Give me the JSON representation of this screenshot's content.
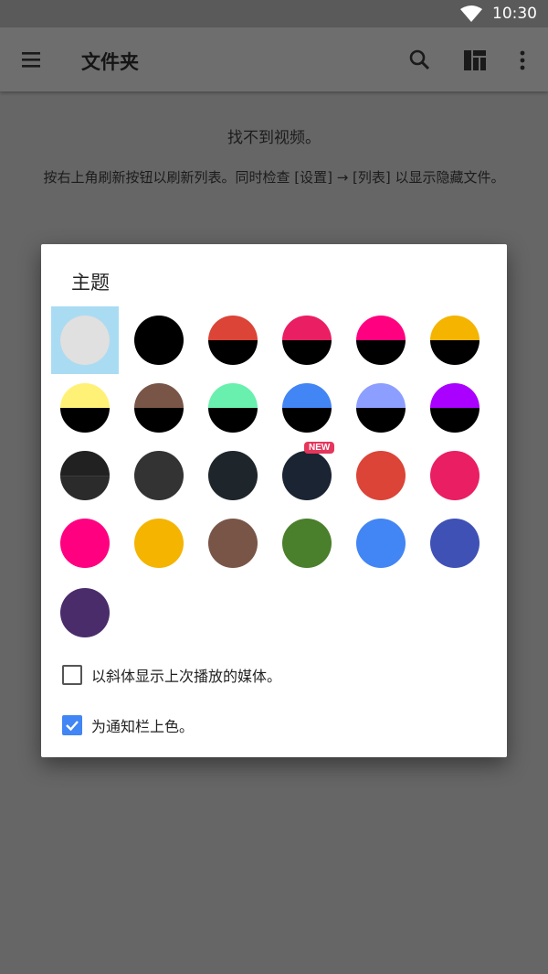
{
  "status_bar": {
    "time": "10:30",
    "wifi_icon": "wifi-icon"
  },
  "app_bar": {
    "title": "文件夹",
    "icons": [
      "menu-icon",
      "search-icon",
      "layout-grid-icon",
      "more-vert-icon"
    ]
  },
  "empty_state": {
    "title": "找不到视频。",
    "hint": "按右上角刷新按钮以刷新列表。同时检查 [设置] → [列表] 以显示隐藏文件。"
  },
  "theme_dialog": {
    "title": "主题",
    "selected_theme": "light-gray",
    "themes": [
      {
        "id": "light-gray",
        "top": "#e0e0e0",
        "bottom": "#e0e0e0"
      },
      {
        "id": "black",
        "top": "#000000",
        "bottom": "#000000"
      },
      {
        "id": "red-black",
        "top": "#db4437",
        "bottom": "#000000"
      },
      {
        "id": "pink-black",
        "top": "#e91e63",
        "bottom": "#000000"
      },
      {
        "id": "magenta-black",
        "top": "#ff0080",
        "bottom": "#000000"
      },
      {
        "id": "amber-black",
        "top": "#f4b400",
        "bottom": "#000000"
      },
      {
        "id": "yellow-black",
        "top": "#fff176",
        "bottom": "#000000"
      },
      {
        "id": "brown-black",
        "top": "#795548",
        "bottom": "#000000"
      },
      {
        "id": "green-black",
        "top": "#69f0ae",
        "bottom": "#000000"
      },
      {
        "id": "blue-black",
        "top": "#4285f4",
        "bottom": "#000000"
      },
      {
        "id": "lavender-black",
        "top": "#8c9eff",
        "bottom": "#000000"
      },
      {
        "id": "purple-black",
        "top": "#aa00ff",
        "bottom": "#000000"
      },
      {
        "id": "charcoal",
        "top": "#212121",
        "bottom": "#2b2b2b"
      },
      {
        "id": "dark-gray",
        "top": "#333333",
        "bottom": "#333333"
      },
      {
        "id": "slate",
        "top": "#1f262b",
        "bottom": "#1f262b"
      },
      {
        "id": "navy-dark",
        "top": "#1a2433",
        "bottom": "#1a2433",
        "badge": "NEW"
      },
      {
        "id": "red",
        "top": "#db4437",
        "bottom": "#db4437"
      },
      {
        "id": "pink",
        "top": "#e91e63",
        "bottom": "#e91e63"
      },
      {
        "id": "magenta",
        "top": "#ff0080",
        "bottom": "#ff0080"
      },
      {
        "id": "amber",
        "top": "#f4b400",
        "bottom": "#f4b400"
      },
      {
        "id": "brown",
        "top": "#795548",
        "bottom": "#795548"
      },
      {
        "id": "green",
        "top": "#4a7f2b",
        "bottom": "#4a7f2b"
      },
      {
        "id": "blue",
        "top": "#4285f4",
        "bottom": "#4285f4"
      },
      {
        "id": "indigo",
        "top": "#3f51b5",
        "bottom": "#3f51b5"
      },
      {
        "id": "deep-purple",
        "top": "#4a2c6b",
        "bottom": "#4a2c6b"
      }
    ],
    "options": [
      {
        "label": "以斜体显示上次播放的媒体。",
        "checked": false
      },
      {
        "label": "为通知栏上色。",
        "checked": true
      }
    ]
  },
  "colors": {
    "accent": "#4285f4",
    "selection": "#a9dcf3",
    "badge": "#e5365c"
  }
}
